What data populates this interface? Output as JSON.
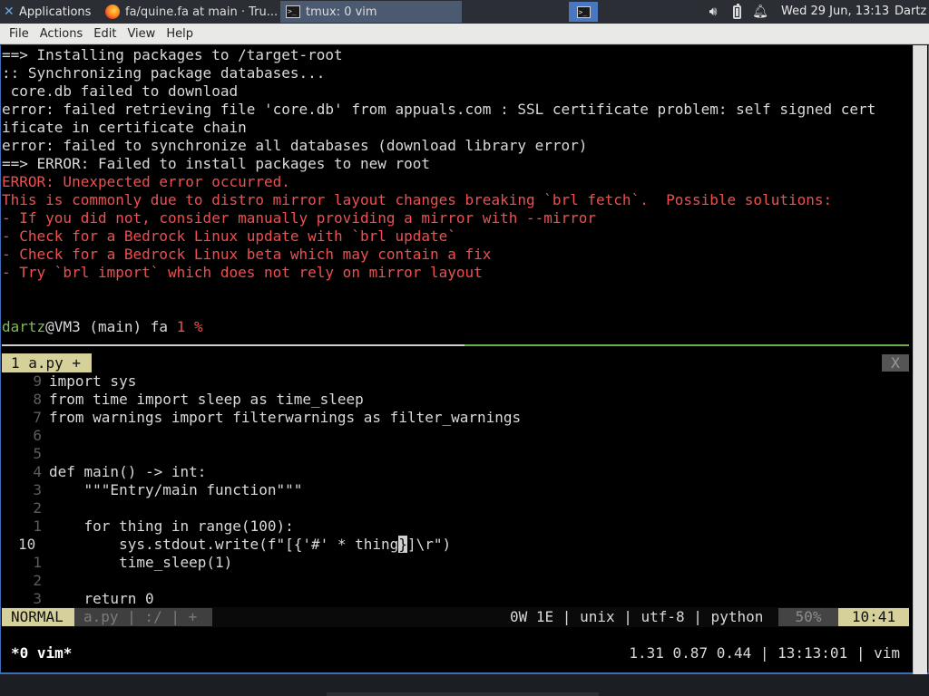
{
  "panel": {
    "applications_label": "Applications",
    "tasks": [
      {
        "title": "fa/quine.fa at main · Tru..."
      },
      {
        "title": "tmux: 0 vim"
      }
    ],
    "clock": "Wed 29 Jun, 13:13",
    "user": "Dartz"
  },
  "menubar": {
    "items": [
      "File",
      "Actions",
      "Edit",
      "View",
      "Help"
    ]
  },
  "terminal_output": [
    {
      "text": "==> Installing packages to /target-root",
      "color": "white"
    },
    {
      "text": ":: Synchronizing package databases...",
      "color": "white"
    },
    {
      "text": " core.db failed to download",
      "color": "white"
    },
    {
      "text": "error: failed retrieving file 'core.db' from appuals.com : SSL certificate problem: self signed cert",
      "color": "white"
    },
    {
      "text": "ificate in certificate chain",
      "color": "white"
    },
    {
      "text": "error: failed to synchronize all databases (download library error)",
      "color": "white"
    },
    {
      "text": "==> ERROR: Failed to install packages to new root",
      "color": "white"
    },
    {
      "text": "ERROR: Unexpected error occurred.",
      "color": "red"
    },
    {
      "text": "This is commonly due to distro mirror layout changes breaking `brl fetch`.  Possible solutions:",
      "color": "red"
    },
    {
      "text": "- If you did not, consider manually providing a mirror with --mirror",
      "color": "red"
    },
    {
      "text": "- Check for a Bedrock Linux update with `brl update`",
      "color": "red"
    },
    {
      "text": "- Check for a Bedrock Linux beta which may contain a fix",
      "color": "red"
    },
    {
      "text": "- Try `brl import` which does not rely on mirror layout",
      "color": "red"
    }
  ],
  "prompt": {
    "user": "dartz",
    "host": "@VM3 (main) fa ",
    "status": "1 %"
  },
  "vim": {
    "tab": "1 a.py +",
    "close": "X",
    "lines": [
      {
        "num": "9",
        "code": "import sys"
      },
      {
        "num": "8",
        "code": "from time import sleep as time_sleep"
      },
      {
        "num": "7",
        "code": "from warnings import filterwarnings as filter_warnings"
      },
      {
        "num": "6",
        "code": ""
      },
      {
        "num": "5",
        "code": ""
      },
      {
        "num": "4",
        "code": "def main() -> int:"
      },
      {
        "num": "3",
        "code": "    \"\"\"Entry/main function\"\"\""
      },
      {
        "num": "2",
        "code": ""
      },
      {
        "num": "1",
        "code": "    for thing in range(100):"
      },
      {
        "num": "10",
        "code_pre": "        sys.stdout.write(f\"[{'#' * thing",
        "cursor_char": "}",
        "code_post": "]\\r\")",
        "current": true
      },
      {
        "num": "1",
        "code": "        time_sleep(1)"
      },
      {
        "num": "2",
        "code": ""
      },
      {
        "num": "3",
        "code": "    return 0"
      }
    ],
    "status": {
      "mode": "NORMAL",
      "file": "a.py | :/ | +",
      "info": "0W 1E | unix | utf-8 | python",
      "percent": "50%",
      "position": "10:41"
    }
  },
  "tmux": {
    "window": "*0 vim*",
    "right": "1.31 0.87 0.44 | 13:13:01 | vim"
  }
}
